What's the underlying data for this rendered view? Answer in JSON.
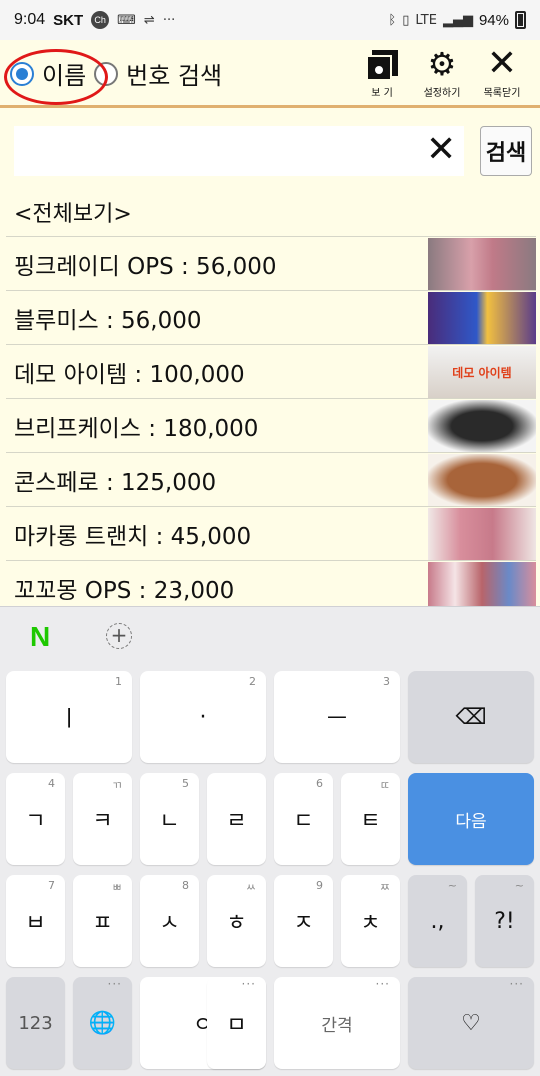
{
  "status_bar": {
    "time": "9:04",
    "carrier": "SKT",
    "ch_badge": "Ch",
    "battery": "94%",
    "lte": "LTE"
  },
  "header": {
    "radio_name": "이름",
    "radio_number": "번호 검색",
    "view_label": "보 기",
    "settings_label": "설정하기",
    "close_label": "목록닫기"
  },
  "search": {
    "value": "",
    "placeholder": "",
    "button_label": "검색"
  },
  "show_all": "<전체보기>",
  "items": [
    {
      "text": "핑크레이디 OPS : 56,000",
      "thumb_color": "#c98f9a"
    },
    {
      "text": "블루미스 : 56,000",
      "thumb_color": "#3450b0"
    },
    {
      "text": "데모 아이템 : 100,000",
      "thumb_color": "#e6e6e6",
      "thumb_text": "데모 아이템"
    },
    {
      "text": "브리프케이스 : 180,000",
      "thumb_color": "#262626"
    },
    {
      "text": "콘스페로 : 125,000",
      "thumb_color": "#a8643a"
    },
    {
      "text": "마카롱 트랜치 : 45,000",
      "thumb_color": "#d99aa5"
    },
    {
      "text": "꼬꼬몽 OPS : 23,000",
      "thumb_color": "#c78a9c"
    }
  ],
  "keyboard": {
    "logo": "N",
    "row1": [
      {
        "label": "ㅣ",
        "hint": "1"
      },
      {
        "label": "·",
        "hint": "2"
      },
      {
        "label": "ㅡ",
        "hint": "3"
      }
    ],
    "backspace": "⌫",
    "row2": [
      {
        "label": "ㄱ",
        "hint": "4"
      },
      {
        "label": "ㅋ",
        "hint": "ㄲ"
      },
      {
        "label": "ㄴ",
        "hint": "5"
      },
      {
        "label": "ㄹ",
        "hint": ""
      },
      {
        "label": "ㄷ",
        "hint": "6"
      },
      {
        "label": "ㅌ",
        "hint": "ㄸ"
      }
    ],
    "next_label": "다음",
    "row3": [
      {
        "label": "ㅂ",
        "hint": "7"
      },
      {
        "label": "ㅍ",
        "hint": "ㅃ"
      },
      {
        "label": "ㅅ",
        "hint": "8"
      },
      {
        "label": "ㅎ",
        "hint": "ㅆ"
      },
      {
        "label": "ㅈ",
        "hint": "9"
      },
      {
        "label": "ㅊ",
        "hint": "ㅉ"
      }
    ],
    "punct1": ".,",
    "punct2": "?!",
    "row4": {
      "num": "123",
      "globe": "🌐",
      "o": "ㅇ",
      "o_hint": "0",
      "m": "ㅁ",
      "space": "간격",
      "heart": "♡"
    }
  }
}
